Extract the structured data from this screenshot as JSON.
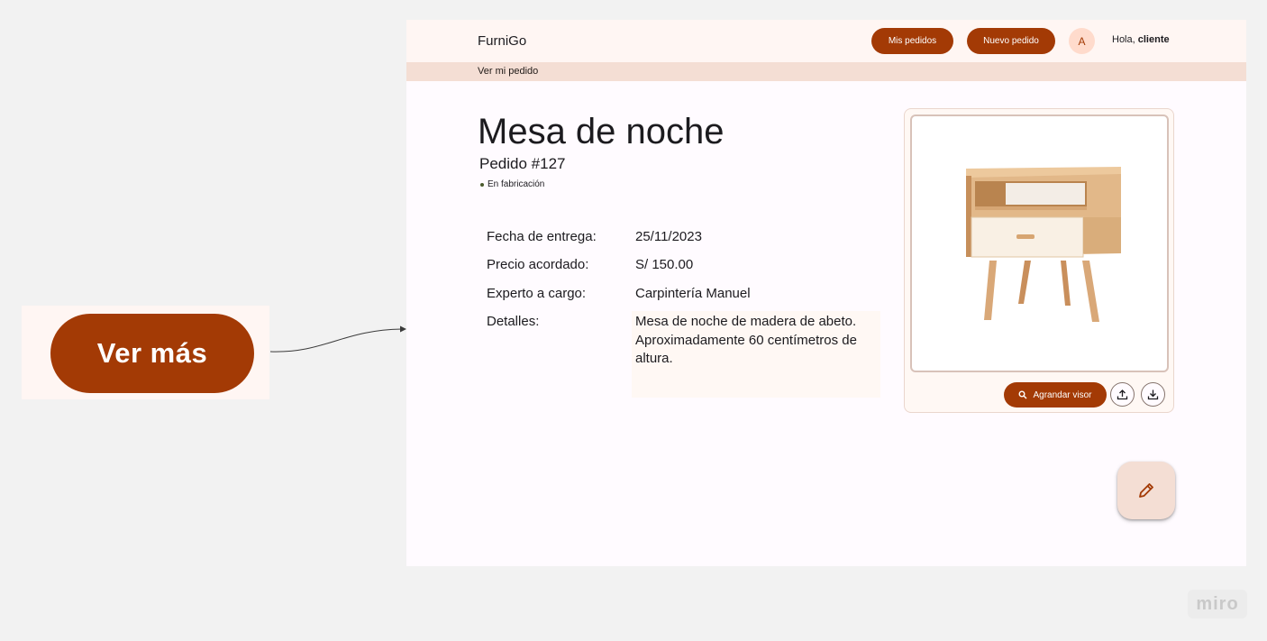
{
  "zoom_card": {
    "button_label": "Ver más"
  },
  "app": {
    "brand": "FurniGo",
    "nav": {
      "orders_label": "Mis pedidos",
      "new_order_label": "Nuevo pedido"
    },
    "avatar_initial": "A",
    "greeting_prefix": "Hola, ",
    "greeting_user": "cliente",
    "breadcrumb": "Ver mi pedido"
  },
  "order": {
    "title": "Mesa de noche",
    "number": "Pedido #127",
    "status": "En fabricación",
    "fields": [
      {
        "label": "Fecha de entrega:",
        "value": "25/11/2023"
      },
      {
        "label": "Precio acordado:",
        "value": "S/ 150.00"
      },
      {
        "label": "Experto a cargo:",
        "value": "Carpintería Manuel"
      }
    ],
    "details_label": "Detalles:",
    "details_text": "Mesa de noche de madera de abeto. Aproximadamente 60 centímetros de altura."
  },
  "viewer": {
    "enlarge_label": "Agrandar visor"
  },
  "watermark": "miro",
  "colors": {
    "primary": "#a33a05",
    "surface": "#fff6f3",
    "crumb_bg": "#f4ded4",
    "canvas": "#f2f2f2"
  },
  "icons": [
    "search-icon",
    "upload-icon",
    "download-icon",
    "edit-pencil-icon"
  ]
}
